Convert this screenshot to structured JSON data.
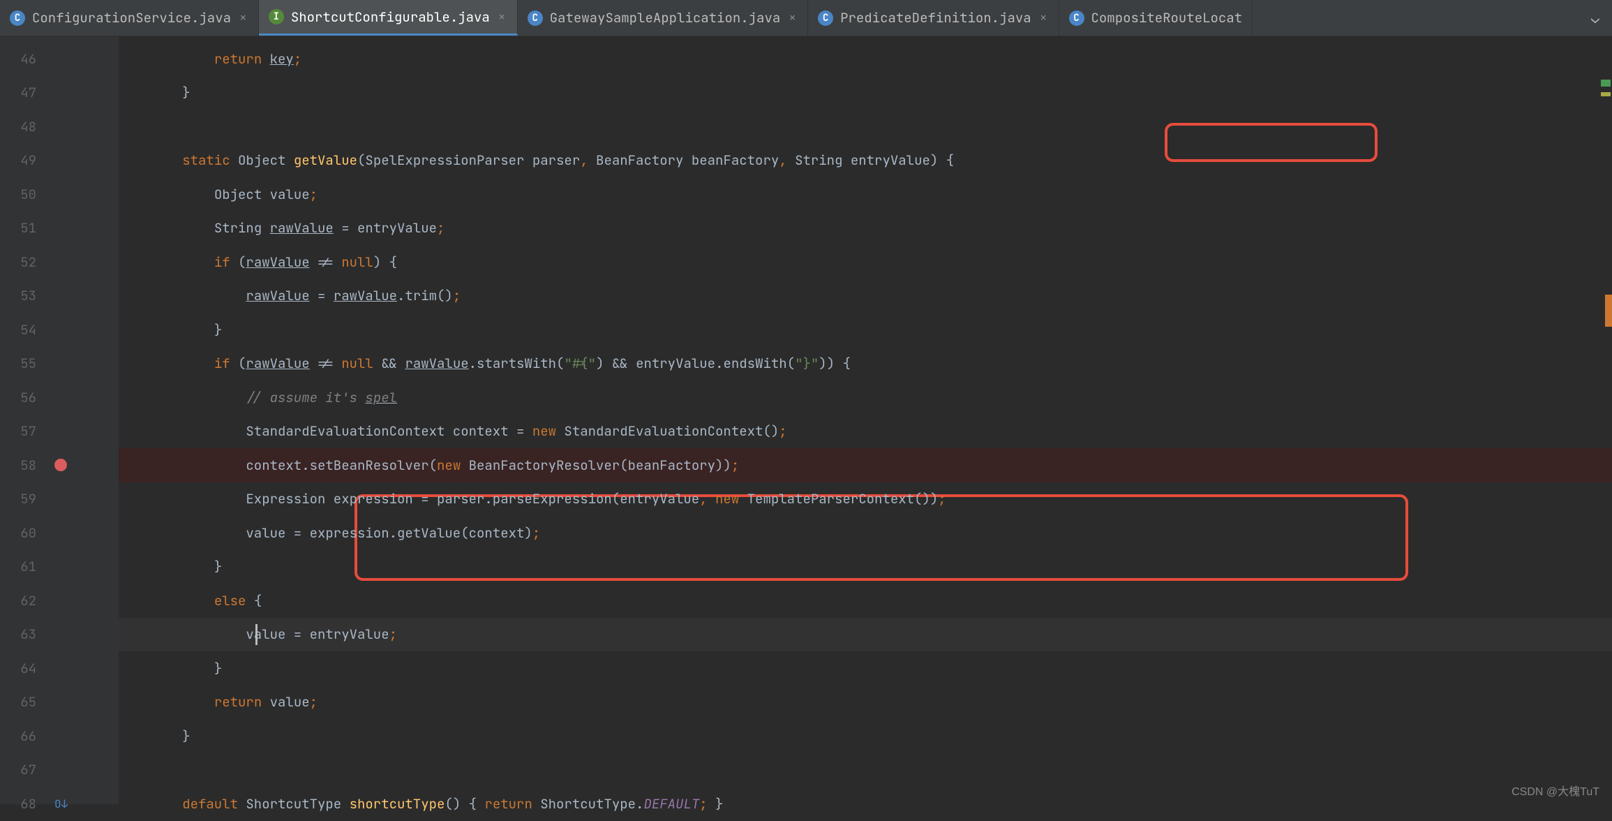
{
  "tabs": [
    {
      "icon": "C",
      "iconClass": "icon-c",
      "label": "ConfigurationService.java",
      "active": false
    },
    {
      "icon": "I",
      "iconClass": "icon-i",
      "label": "ShortcutConfigurable.java",
      "active": true
    },
    {
      "icon": "C",
      "iconClass": "icon-c2",
      "label": "GatewaySampleApplication.java",
      "active": false
    },
    {
      "icon": "C",
      "iconClass": "icon-c",
      "label": "PredicateDefinition.java",
      "active": false
    },
    {
      "icon": "C",
      "iconClass": "icon-c",
      "label": "CompositeRouteLocat",
      "active": false,
      "noClose": true
    }
  ],
  "lines": {
    "start": 46,
    "end": 68
  },
  "code": {
    "l46": {
      "indent": "            ",
      "parts": [
        {
          "t": "return ",
          "c": "kw"
        },
        {
          "t": "key",
          "c": "underline"
        },
        {
          "t": ";",
          "c": "semi"
        }
      ]
    },
    "l47": {
      "indent": "        ",
      "parts": [
        {
          "t": "}",
          "c": "paren"
        }
      ]
    },
    "l48": {
      "indent": "",
      "parts": []
    },
    "l49": {
      "indent": "        ",
      "parts": [
        {
          "t": "static ",
          "c": "kw"
        },
        {
          "t": "Object ",
          "c": "type"
        },
        {
          "t": "getValue",
          "c": "method"
        },
        {
          "t": "(SpelExpressionParser parser",
          "c": "paren"
        },
        {
          "t": ", ",
          "c": "semi"
        },
        {
          "t": "BeanFactory beanFactory",
          "c": "type"
        },
        {
          "t": ", ",
          "c": "semi"
        },
        {
          "t": "String entryValue) {",
          "c": "type"
        }
      ]
    },
    "l50": {
      "indent": "            ",
      "parts": [
        {
          "t": "Object value",
          "c": "type"
        },
        {
          "t": ";",
          "c": "semi"
        }
      ]
    },
    "l51": {
      "indent": "            ",
      "parts": [
        {
          "t": "String ",
          "c": "type"
        },
        {
          "t": "rawValue",
          "c": "underline"
        },
        {
          "t": " = entryValue",
          "c": "type"
        },
        {
          "t": ";",
          "c": "semi"
        }
      ]
    },
    "l52": {
      "indent": "            ",
      "parts": [
        {
          "t": "if ",
          "c": "kw"
        },
        {
          "t": "(",
          "c": "paren"
        },
        {
          "t": "rawValue",
          "c": "underline"
        },
        {
          "t": " != ",
          "c": "type"
        },
        {
          "t": "null",
          "c": "kw"
        },
        {
          "t": ") {",
          "c": "paren"
        }
      ]
    },
    "l53": {
      "indent": "                ",
      "parts": [
        {
          "t": "rawValue",
          "c": "underline"
        },
        {
          "t": " = ",
          "c": "type"
        },
        {
          "t": "rawValue",
          "c": "underline"
        },
        {
          "t": ".trim()",
          "c": "type"
        },
        {
          "t": ";",
          "c": "semi"
        }
      ]
    },
    "l54": {
      "indent": "            ",
      "parts": [
        {
          "t": "}",
          "c": "paren"
        }
      ]
    },
    "l55": {
      "indent": "            ",
      "parts": [
        {
          "t": "if ",
          "c": "kw"
        },
        {
          "t": "(",
          "c": "paren"
        },
        {
          "t": "rawValue",
          "c": "underline"
        },
        {
          "t": " != ",
          "c": "type"
        },
        {
          "t": "null ",
          "c": "kw"
        },
        {
          "t": "&& ",
          "c": "type"
        },
        {
          "t": "rawValue",
          "c": "underline"
        },
        {
          "t": ".startsWith(",
          "c": "type"
        },
        {
          "t": "\"#{\"",
          "c": "str"
        },
        {
          "t": ") && entryValue.endsWith(",
          "c": "type"
        },
        {
          "t": "\"}\"",
          "c": "str"
        },
        {
          "t": ")) {",
          "c": "paren"
        }
      ]
    },
    "l56": {
      "indent": "                ",
      "parts": [
        {
          "t": "// assume it's ",
          "c": "comment"
        },
        {
          "t": "spel",
          "c": "comment underline"
        }
      ]
    },
    "l57": {
      "indent": "                ",
      "parts": [
        {
          "t": "StandardEvaluationContext context = ",
          "c": "type"
        },
        {
          "t": "new ",
          "c": "kw"
        },
        {
          "t": "StandardEvaluationContext()",
          "c": "type"
        },
        {
          "t": ";",
          "c": "semi"
        }
      ]
    },
    "l58": {
      "indent": "                ",
      "parts": [
        {
          "t": "context.setBeanResolver(",
          "c": "type"
        },
        {
          "t": "new ",
          "c": "kw"
        },
        {
          "t": "BeanFactoryResolver(beanFactory))",
          "c": "type"
        },
        {
          "t": ";",
          "c": "semi"
        }
      ],
      "bp": true
    },
    "l59": {
      "indent": "                ",
      "parts": [
        {
          "t": "Expression expression = parser.parseExpression(entryValue",
          "c": "type"
        },
        {
          "t": ", ",
          "c": "semi"
        },
        {
          "t": "new ",
          "c": "kw"
        },
        {
          "t": "TemplateParserContext())",
          "c": "type"
        },
        {
          "t": ";",
          "c": "semi"
        }
      ]
    },
    "l60": {
      "indent": "                ",
      "parts": [
        {
          "t": "value = expression.getValue(context)",
          "c": "type"
        },
        {
          "t": ";",
          "c": "semi"
        }
      ]
    },
    "l61": {
      "indent": "            ",
      "parts": [
        {
          "t": "}",
          "c": "paren"
        }
      ]
    },
    "l62": {
      "indent": "            ",
      "parts": [
        {
          "t": "else ",
          "c": "kw"
        },
        {
          "t": "{",
          "c": "paren"
        }
      ]
    },
    "l63": {
      "indent": "                ",
      "parts": [
        {
          "t": "value = entryValue",
          "c": "type"
        },
        {
          "t": ";",
          "c": "semi"
        }
      ],
      "current": true
    },
    "l64": {
      "indent": "            ",
      "parts": [
        {
          "t": "}",
          "c": "paren"
        }
      ]
    },
    "l65": {
      "indent": "            ",
      "parts": [
        {
          "t": "return ",
          "c": "kw"
        },
        {
          "t": "value",
          "c": "type"
        },
        {
          "t": ";",
          "c": "semi"
        }
      ]
    },
    "l66": {
      "indent": "        ",
      "parts": [
        {
          "t": "}",
          "c": "paren"
        }
      ]
    },
    "l67": {
      "indent": "",
      "parts": []
    },
    "l68": {
      "indent": "        ",
      "parts": [
        {
          "t": "default ",
          "c": "kw"
        },
        {
          "t": "ShortcutType ",
          "c": "type"
        },
        {
          "t": "shortcutType",
          "c": "method"
        },
        {
          "t": "() { ",
          "c": "paren"
        },
        {
          "t": "return ",
          "c": "kw"
        },
        {
          "t": "ShortcutType.",
          "c": "type"
        },
        {
          "t": "DEFAULT",
          "c": "field-italic"
        },
        {
          "t": ";",
          "c": "semi"
        },
        {
          "t": " }",
          "c": "paren"
        }
      ]
    }
  },
  "watermark": "CSDN @大槐TuT"
}
